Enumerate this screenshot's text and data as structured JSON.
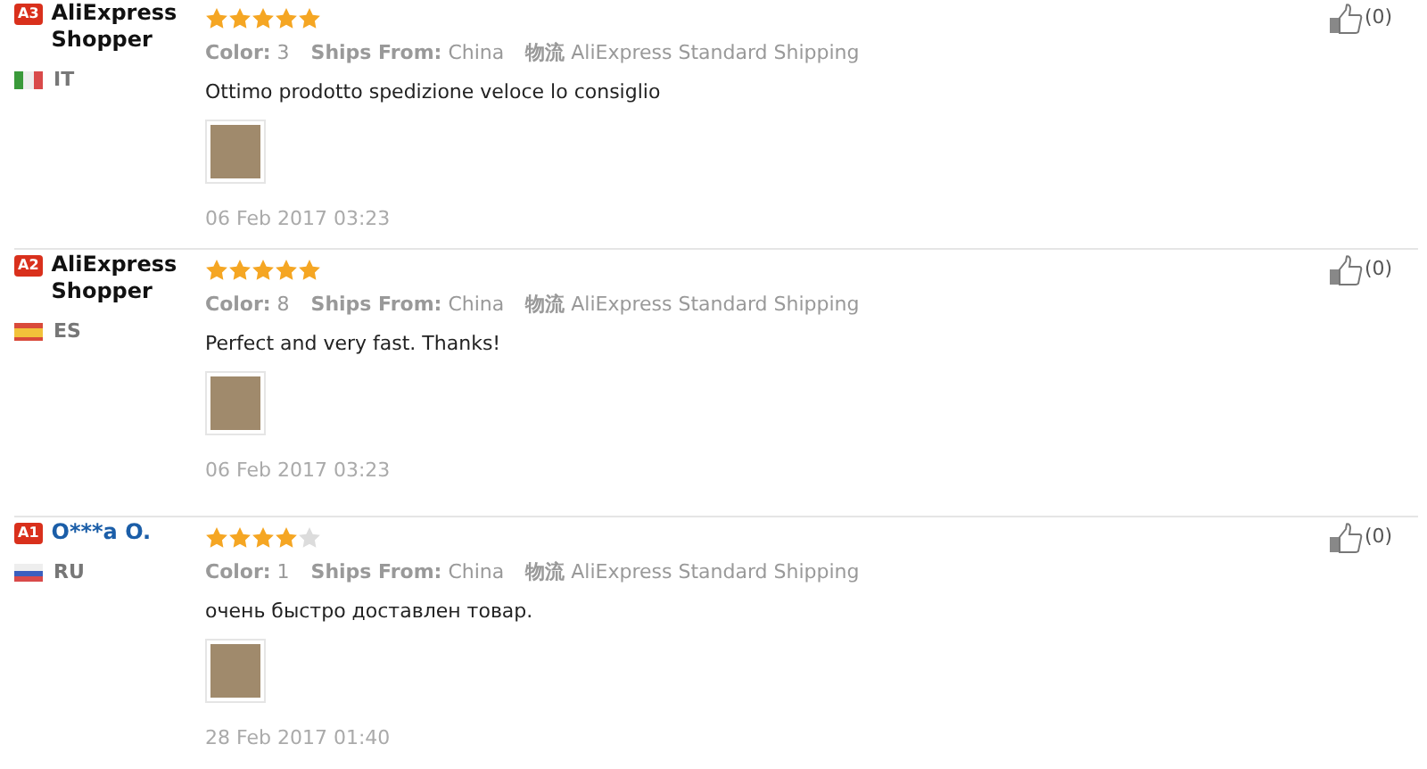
{
  "reviews": [
    {
      "level_badge": "A3",
      "reviewer": {
        "kind": "plain",
        "name": "AliExpress Shopper"
      },
      "flag": {
        "kind": "vertical"
      },
      "country": "IT",
      "stars": 5,
      "color_label": "Color:",
      "color_value": "3",
      "ships_label": "Ships From:",
      "ships_value": "China",
      "logistics_label": "物流",
      "logistics_value": "AliExpress Standard Shipping",
      "text": "Ottimo prodotto spedizione veloce lo consiglio",
      "date": "06 Feb 2017 03:23",
      "likes": "(0)"
    },
    {
      "level_badge": "A2",
      "reviewer": {
        "kind": "plain",
        "name": "AliExpress Shopper"
      },
      "flag": {
        "kind": "banded"
      },
      "country": "ES",
      "stars": 5,
      "color_label": "Color:",
      "color_value": "8",
      "ships_label": "Ships From:",
      "ships_value": "China",
      "logistics_label": "物流",
      "logistics_value": "AliExpress Standard Shipping",
      "text": "Perfect and very fast. Thanks!",
      "date": "06 Feb 2017 03:23",
      "likes": "(0)"
    },
    {
      "level_badge": "A1",
      "reviewer": {
        "kind": "link",
        "name": "O***a O."
      },
      "flag": {
        "kind": "horizontal"
      },
      "country": "RU",
      "stars": 4,
      "color_label": "Color:",
      "color_value": "1",
      "ships_label": "Ships From:",
      "ships_value": "China",
      "logistics_label": "物流",
      "logistics_value": "AliExpress Standard Shipping",
      "text": "очень быстро доставлен товар.",
      "date": "28 Feb 2017 01:40",
      "likes": "(0)"
    }
  ]
}
